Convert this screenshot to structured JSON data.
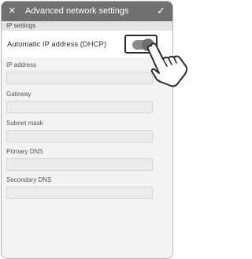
{
  "header": {
    "close_icon": "×",
    "title": "Advanced network settings",
    "confirm_icon": "✓"
  },
  "section": {
    "title": "IP settings"
  },
  "dhcp": {
    "label": "Automatic IP address (DHCP)",
    "enabled": true
  },
  "fields": [
    {
      "label": "IP address",
      "value": ""
    },
    {
      "label": "Gateway",
      "value": ""
    },
    {
      "label": "Subnet mask",
      "value": ""
    },
    {
      "label": "Primary DNS",
      "value": ""
    },
    {
      "label": "Secondary DNS",
      "value": ""
    }
  ],
  "colors": {
    "header_bg": "#707070",
    "toggle_track": "#8a8a8a",
    "toggle_knob": "#6d6d6d"
  },
  "icons": [
    "close-icon",
    "check-icon",
    "pointing-hand-icon"
  ]
}
